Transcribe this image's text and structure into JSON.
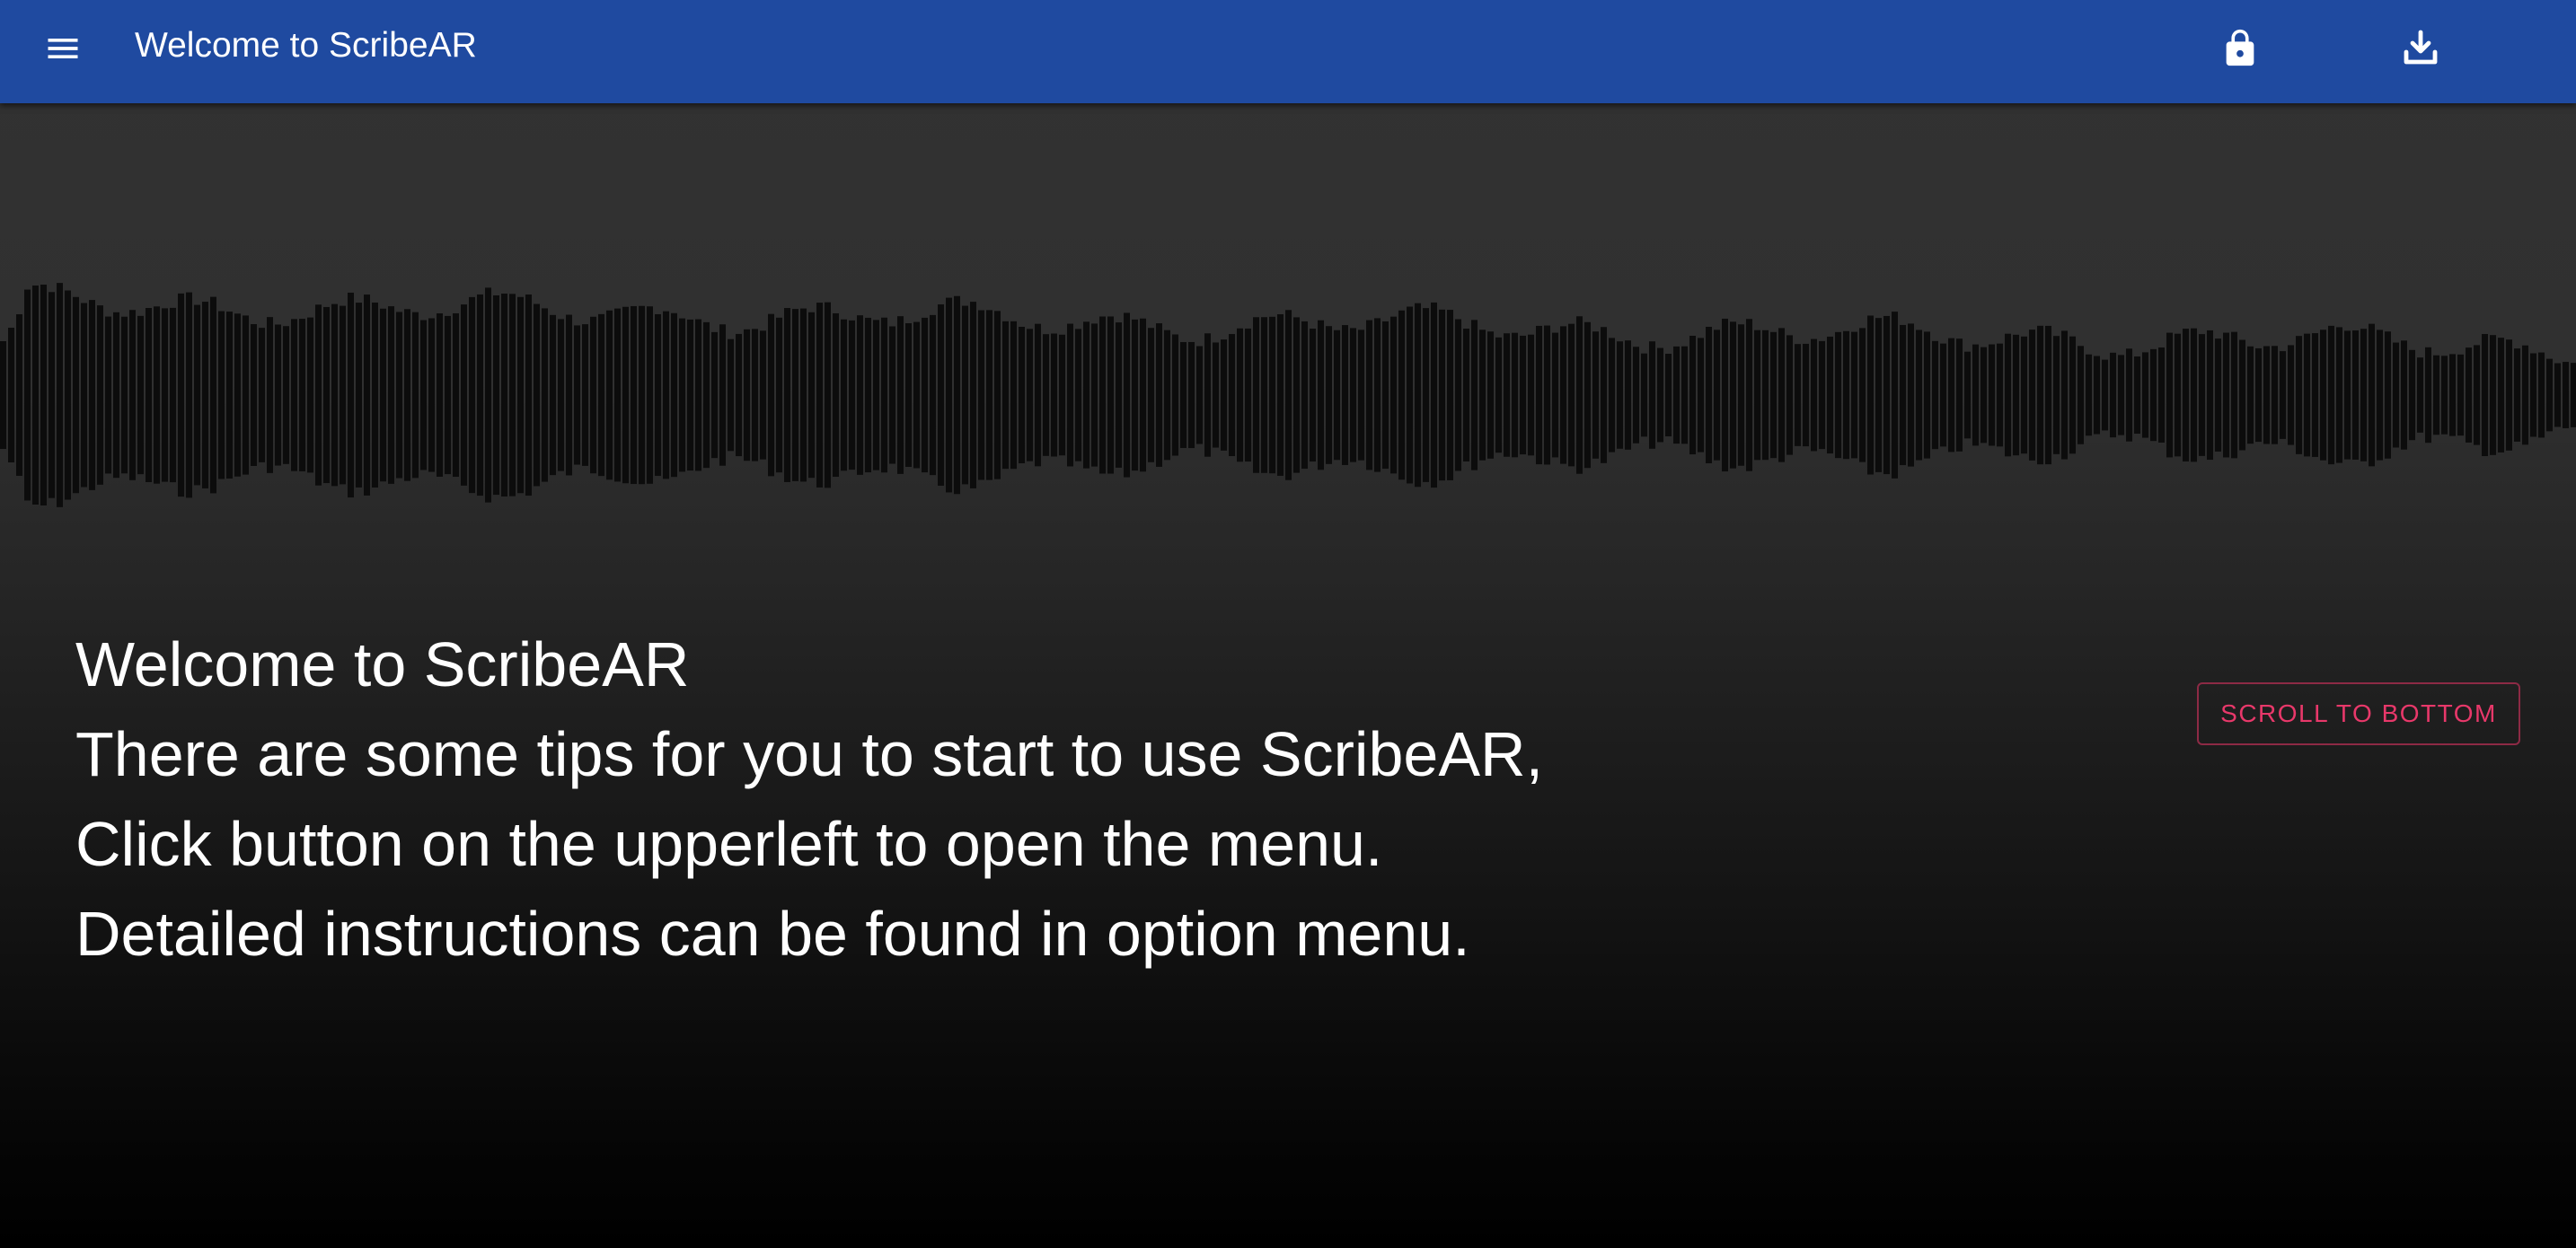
{
  "appbar": {
    "title": "Welcome to ScribeAR",
    "menu_icon": "hamburger-menu-icon",
    "lock_icon": "lock-icon",
    "download_icon": "download-icon",
    "background_color": "#1f4aa0"
  },
  "transcript": {
    "lines": [
      "Welcome to ScribeAR",
      "There are some tips for you to start to use ScribeAR,",
      "Click button on the upperleft to open the menu.",
      "Detailed instructions can be found in option menu."
    ]
  },
  "scroll_button": {
    "label": "SCROLL TO BOTTOM",
    "color": "#e8386a"
  },
  "waveform": {
    "bar_color": "#0c0c0c"
  }
}
